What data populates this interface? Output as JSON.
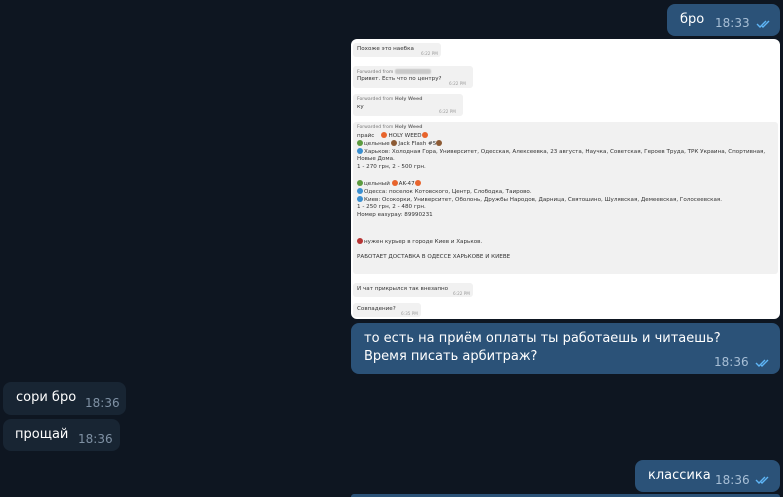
{
  "messages": {
    "m1": {
      "text": "бро",
      "time": "18:33"
    },
    "m2": {
      "text": "то есть на приём оплаты ты работаешь и читаешь? Время писать арбитраж?",
      "time": "18:36"
    },
    "m3": {
      "text": "сори бро",
      "time": "18:36"
    },
    "m4": {
      "text": "прощай",
      "time": "18:36"
    },
    "m5": {
      "text": "классика",
      "time": "18:36"
    }
  },
  "screenshot": {
    "b1": {
      "text": "Похоже это наебка",
      "time": "6:22 PM"
    },
    "b2": {
      "label": "Forwarded from",
      "text": "Привет. Есть что по центру?",
      "time": "6:22 PM"
    },
    "b3": {
      "label": "Forwarded from",
      "sender": "Holy Weed",
      "text": "ку",
      "time": "6:22 PM"
    },
    "b4": {
      "label": "Forwarded from",
      "sender": "Holy Weed",
      "l1_prefix": "прайс",
      "l1_name": "HOLY WEED",
      "l2": "цельные",
      "l2_name": "Jack Flash #5",
      "l3": "Харьков: Холодная Гора, Университет, Одесская, Алексеевка, 23 августа, Научка, Советская, Героев Труда, ТРК Украина, Спортивная,",
      "l4": "Новые Дома.",
      "l5": "1 - 270 грн, 2 - 500 грн.",
      "l6": "цельный",
      "l6_name": "AK-47",
      "l7": "Одесса: поселок Котовского, Центр, Слободка, Таирово.",
      "l8": "Киев: Осокорки, Университет, Оболонь, Дружбы Народов, Дарница, Святошино, Шулявская, Демеевская, Голосеевская.",
      "l9": "1 - 250 грн, 2 - 480 грн.",
      "l10": "Номер easypay:    89990231",
      "l11": "нужен курьер в городе Киев и Харьков.",
      "l12": "РАБОТАЕТ ДОСТАВКА В ОДЕССЕ ХАРЬКОВЕ И КИЕВЕ"
    },
    "b5": {
      "text": "И чат прикрылся так внезапно",
      "time": "6:22 PM"
    },
    "b6": {
      "text": "Совпадение?",
      "time": "6:35 PM"
    }
  },
  "colors": {
    "background": "#0e1621",
    "outgoing": "#2b5278",
    "incoming": "#182533",
    "read_ticks": "#5fb6f7"
  }
}
